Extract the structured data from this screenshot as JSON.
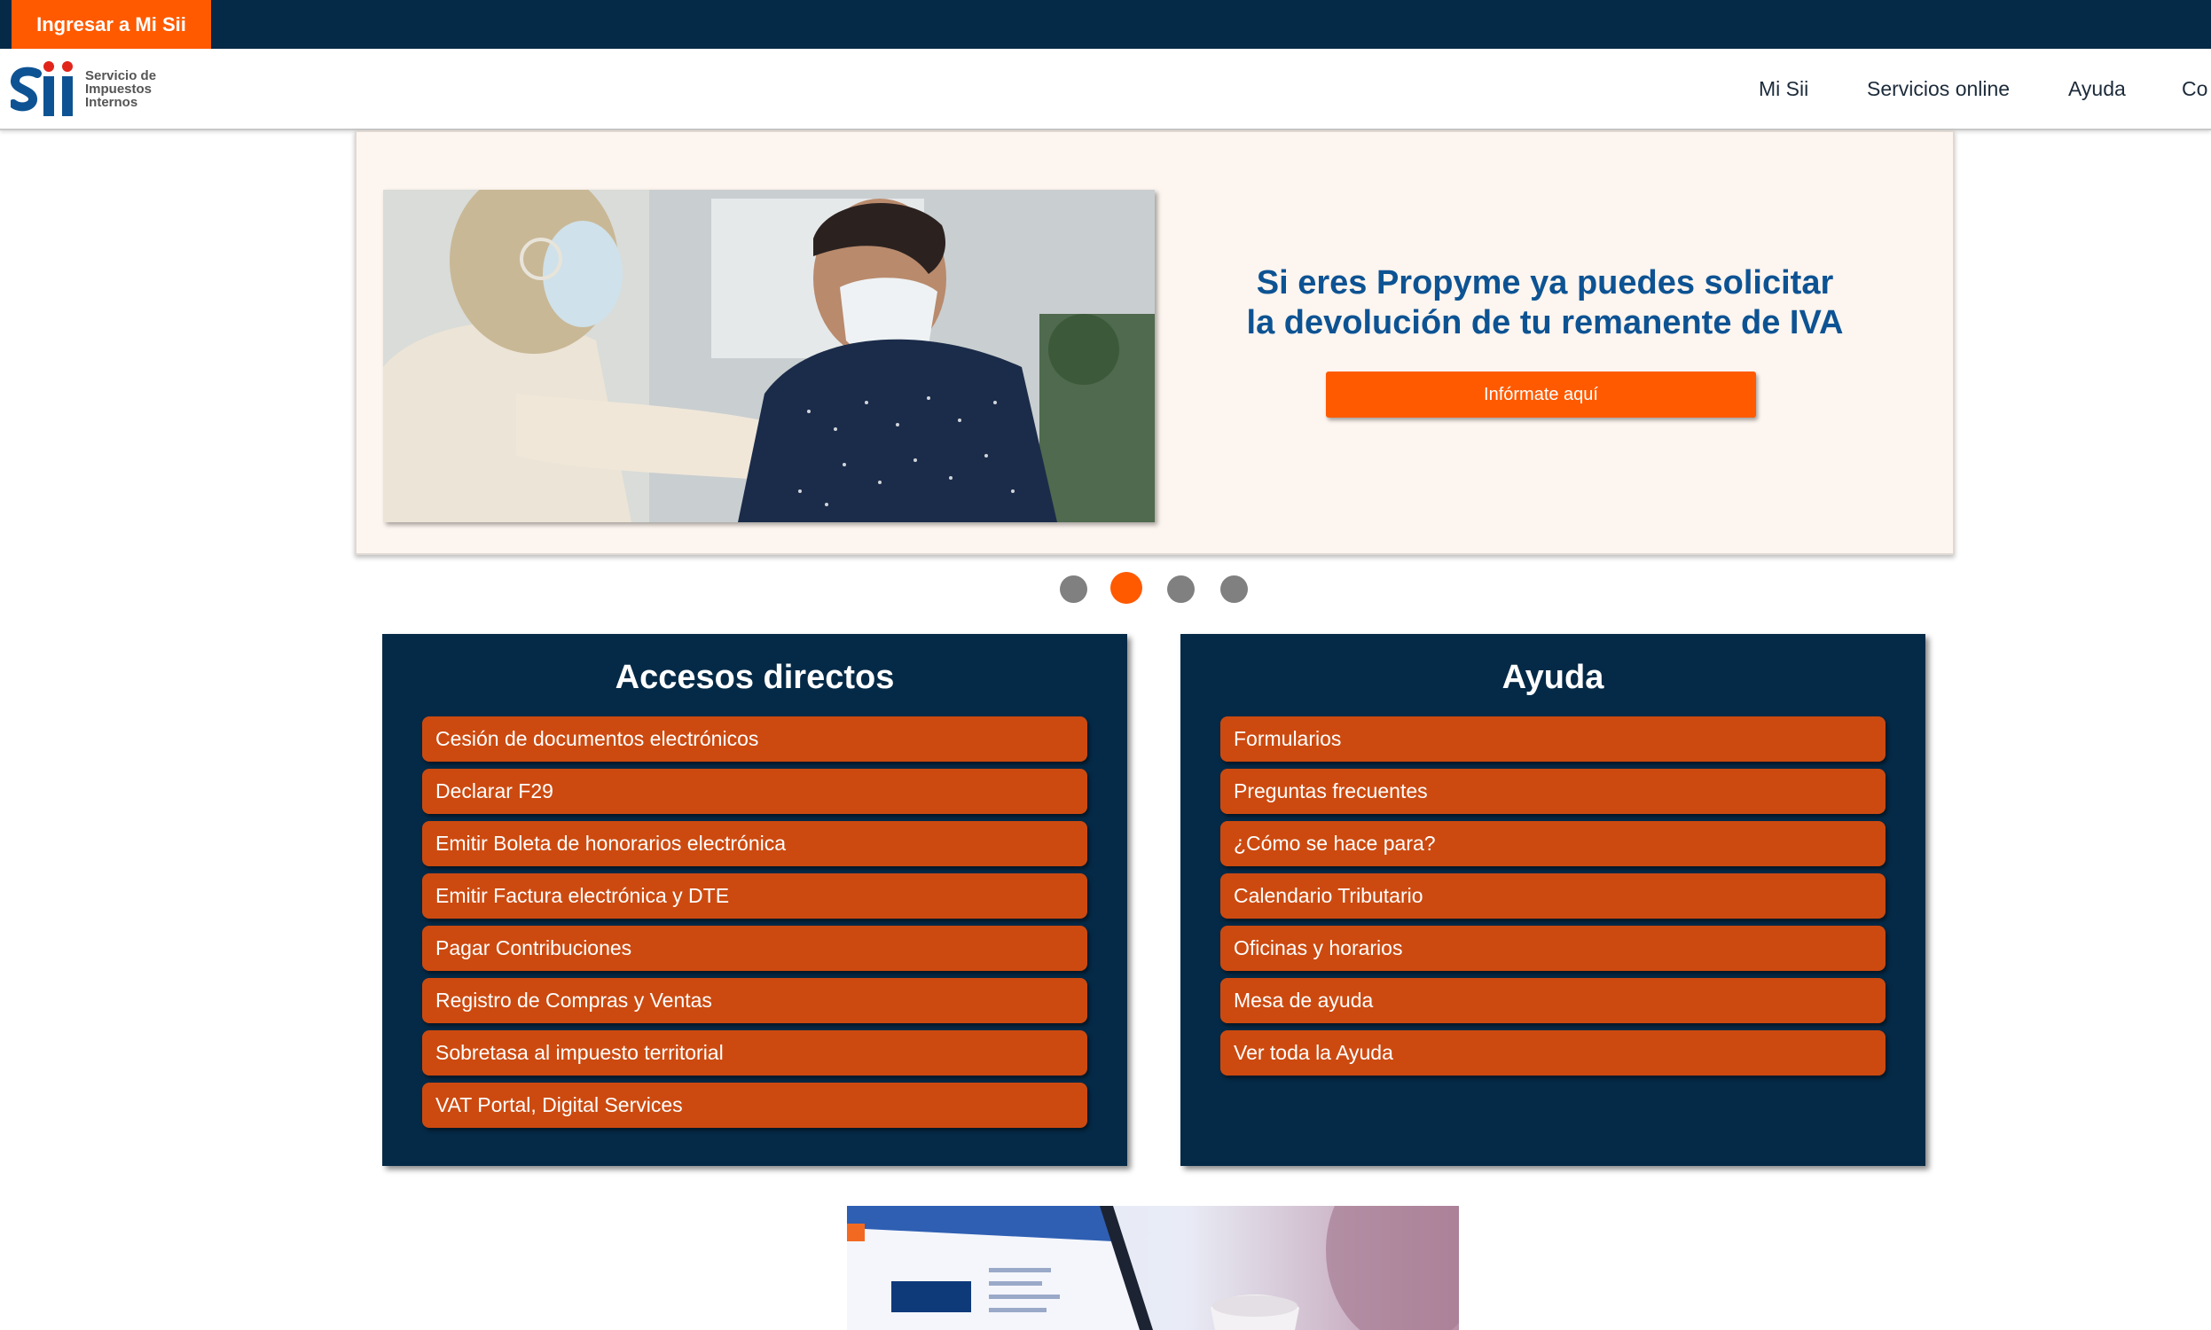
{
  "topbar": {
    "login_label": "Ingresar a Mi Sii"
  },
  "logo": {
    "mark": "Sii",
    "lines": [
      "Servicio de",
      "Impuestos",
      "Internos"
    ]
  },
  "nav": {
    "items": [
      "Mi Sii",
      "Servicios online",
      "Ayuda",
      "Co"
    ]
  },
  "banner": {
    "title": "Si eres Propyme ya puedes solicitar la devolución de tu remanente de IVA",
    "button_label": "Infórmate aquí",
    "photo": "two-people-masks-elbow-greeting-photo"
  },
  "carousel": {
    "total": 4,
    "active_index": 1
  },
  "accesos": {
    "title": "Accesos directos",
    "items": [
      "Cesión de documentos electrónicos",
      "Declarar F29",
      "Emitir Boleta de honorarios electrónica",
      "Emitir Factura electrónica y DTE",
      "Pagar Contribuciones",
      "Registro de Compras y Ventas",
      "Sobretasa al impuesto territorial",
      "VAT Portal, Digital Services"
    ]
  },
  "ayuda": {
    "title": "Ayuda",
    "items": [
      "Formularios",
      "Preguntas frecuentes",
      "¿Cómo se hace para?",
      "Calendario Tributario",
      "Oficinas y horarios",
      "Mesa de ayuda",
      "Ver toda la Ayuda"
    ]
  },
  "colors": {
    "navy": "#052a47",
    "orange": "#ff5a00",
    "link_orange": "#cc4a10",
    "title_blue": "#0d5393"
  }
}
